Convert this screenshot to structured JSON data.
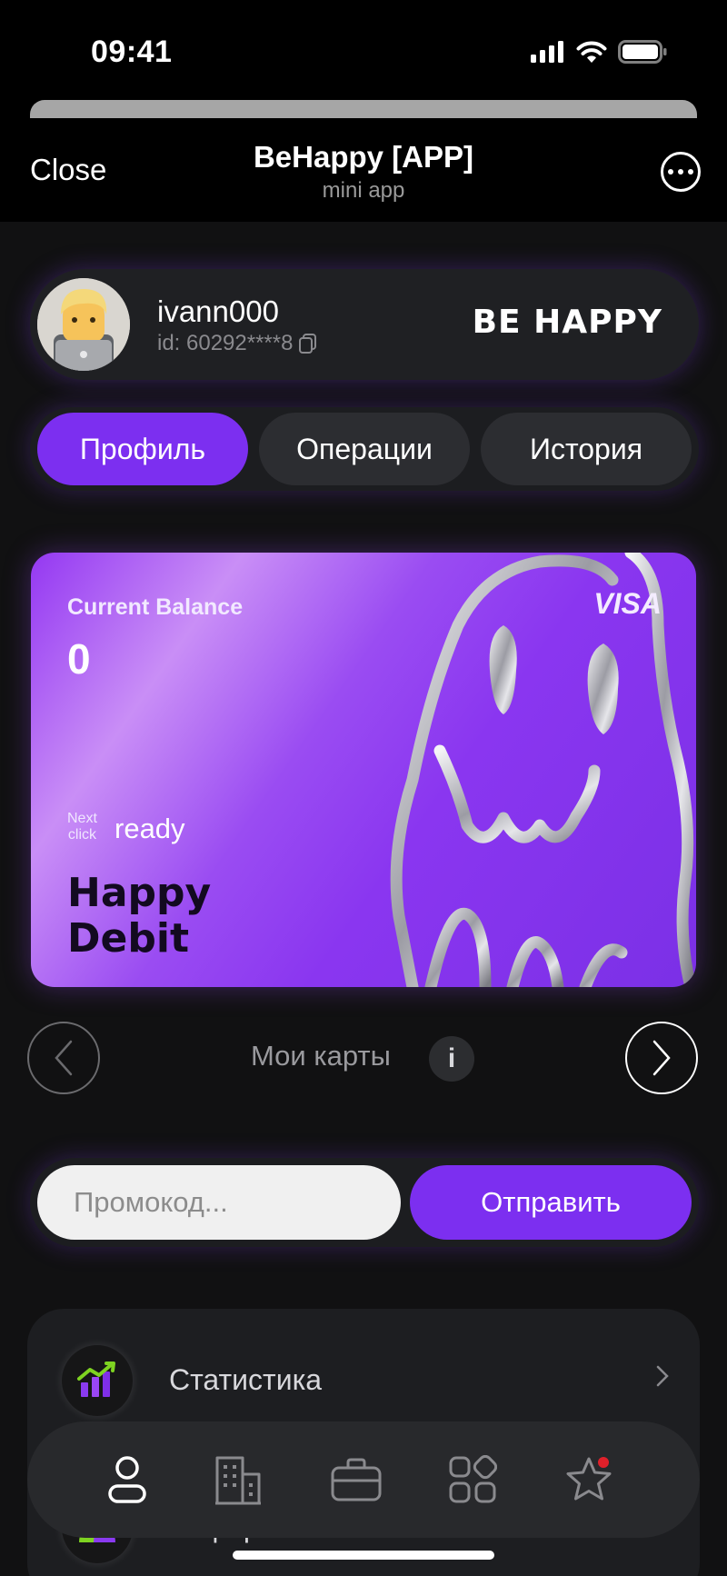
{
  "status_bar": {
    "time": "09:41"
  },
  "header": {
    "close_label": "Close",
    "title": "BeHappy [APP]",
    "subtitle": "mini app",
    "more_icon": "more-dots-icon"
  },
  "profile": {
    "username": "ivann000",
    "id_text": "id: 60292****8",
    "brand": "BE HAPPY"
  },
  "tabs": [
    {
      "label": "Профиль",
      "active": true
    },
    {
      "label": "Операции",
      "active": false
    },
    {
      "label": "История",
      "active": false
    }
  ],
  "card": {
    "balance_label": "Current Balance",
    "balance_value": "0",
    "network": "VISA",
    "next_click_line1": "Next",
    "next_click_line2": "click",
    "status": "ready",
    "name_line1": "Happy",
    "name_line2": "Debit"
  },
  "cards_nav": {
    "label": "Мои карты",
    "info": "i"
  },
  "promo": {
    "placeholder": "Промокод...",
    "value": "",
    "button": "Отправить"
  },
  "menu": [
    {
      "label": "Статистика",
      "icon": "stats-chart-icon"
    },
    {
      "label": "Реферальная система",
      "icon": "referral-icon"
    }
  ],
  "bottom_nav": [
    {
      "icon": "profile-icon",
      "active": true
    },
    {
      "icon": "buildings-icon",
      "active": false
    },
    {
      "icon": "briefcase-icon",
      "active": false
    },
    {
      "icon": "grid-apps-icon",
      "active": false
    },
    {
      "icon": "star-icon",
      "active": false,
      "badge": true
    }
  ],
  "colors": {
    "accent": "#7c2ff0",
    "background": "#111112",
    "surface": "#1f2023",
    "badge": "#e0202a"
  }
}
